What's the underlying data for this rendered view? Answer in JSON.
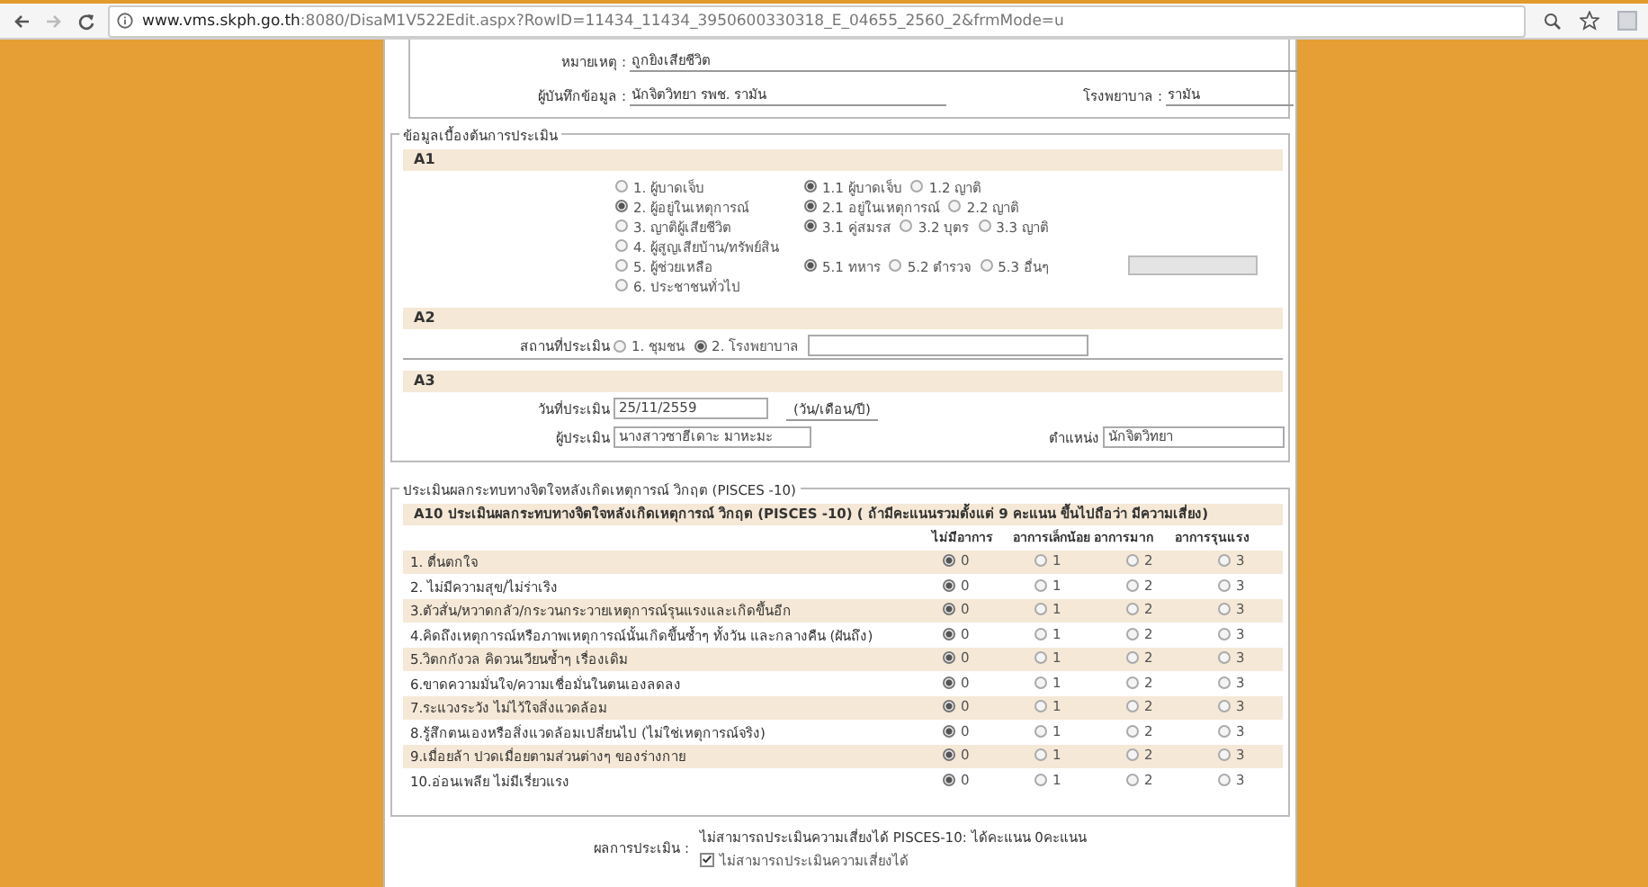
{
  "browser": {
    "url_host": "www.vms.skph.go.th",
    "url_rest": ":8080/DisaM1V522Edit.aspx?RowID=11434_11434_3950600330318_E_04655_2560_2&frmMode=u",
    "forward_disabled": true
  },
  "record": {
    "note_label": "หมายเหตุ :",
    "note": "ถูกยิงเสียชีวิต",
    "recorder_label": "ผู้บันทึกข้อมูล :",
    "recorder": "นักจิตวิทยา รพช. รามัน",
    "hospital_label": "โรงพยาบาล :",
    "hospital": "รามัน"
  },
  "basic_info": {
    "legend": "ข้อมูลเบื้องต้นการประเมิน",
    "a1": {
      "title": "A1",
      "options": [
        {
          "label": "1. ผู้บาดเจ็บ",
          "selected": false,
          "sub_options": [
            {
              "label": "1.1 ผู้บาดเจ็บ",
              "selected": true
            },
            {
              "label": "1.2 ญาติ",
              "selected": false
            }
          ]
        },
        {
          "label": "2. ผู้อยู่ในเหตุการณ์",
          "selected": true,
          "sub_options": [
            {
              "label": "2.1 อยู่ในเหตุการณ์",
              "selected": true
            },
            {
              "label": "2.2 ญาติ",
              "selected": false
            }
          ]
        },
        {
          "label": "3. ญาติผู้เสียชีวิต",
          "selected": false,
          "sub_options": [
            {
              "label": "3.1 คู่สมรส",
              "selected": true
            },
            {
              "label": "3.2 บุตร",
              "selected": false
            },
            {
              "label": "3.3 ญาติ",
              "selected": false
            }
          ]
        },
        {
          "label": "4. ผู้สูญเสียบ้าน/ทรัพย์สิน",
          "selected": false
        },
        {
          "label": "5. ผู้ช่วยเหลือ",
          "selected": false,
          "sub_options": [
            {
              "label": "5.1 ทหาร",
              "selected": true
            },
            {
              "label": "5.2 ตำรวจ",
              "selected": false
            },
            {
              "label": "5.3 อื่นๆ",
              "selected": false
            }
          ],
          "other_field": {
            "disabled": true
          }
        },
        {
          "label": "6. ประชาชนทั่วไป",
          "selected": false
        }
      ]
    },
    "a2": {
      "title": "A2",
      "label": "สถานที่ประเมิน",
      "options": [
        {
          "label": "1. ชุมชน",
          "selected": false
        },
        {
          "label": "2. โรงพยาบาล",
          "selected": true
        }
      ]
    },
    "a3": {
      "title": "A3",
      "date_label": "วันที่ประเมิน",
      "date": "25/11/2559",
      "date_hint": "(วัน/เดือน/ปี)",
      "assessor_label": "ผู้ประเมิน",
      "assessor": "นางสาวซาฮีเดาะ มาหะมะ",
      "position_label": "ตำแหน่ง",
      "position": "นักจิตวิทยา"
    }
  },
  "pisces": {
    "legend": "ประเมินผลกระทบทางจิตใจหลังเกิดเหตุการณ์ วิกฤต (PISCES -10)",
    "header": "A10 ประเมินผลกระทบทางจิตใจหลังเกิดเหตุการณ์ วิกฤต (PISCES -10) ( ถ้ามีคะแนนรวมตั้งแต่ 9 คะแนน ขึ้นไปถือว่า มีความเสี่ยง)",
    "columns": [
      "ไม่มีอาการ",
      "อาการเล็กน้อย",
      "อาการมาก",
      "อาการรุนแรง"
    ],
    "rows": [
      {
        "label": "1. ตื่นตกใจ",
        "options": [
          {
            "label": "0",
            "selected": true
          },
          {
            "label": "1",
            "selected": false
          },
          {
            "label": "2",
            "selected": false
          },
          {
            "label": "3",
            "selected": false
          }
        ]
      },
      {
        "label": "2. ไม่มีความสุข/ไม่ร่าเริง",
        "options": [
          {
            "label": "0",
            "selected": true
          },
          {
            "label": "1",
            "selected": false
          },
          {
            "label": "2",
            "selected": false
          },
          {
            "label": "3",
            "selected": false
          }
        ]
      },
      {
        "label": "3.ตัวสั่น/หวาดกลัว/กระวนกระวายเหตุการณ์รุนแรงและเกิดขึ้นอีก",
        "options": [
          {
            "label": "0",
            "selected": true
          },
          {
            "label": "1",
            "selected": false
          },
          {
            "label": "2",
            "selected": false
          },
          {
            "label": "3",
            "selected": false
          }
        ]
      },
      {
        "label": "4.คิดถึงเหตุการณ์หรือภาพเหตุการณ์นั้นเกิดขึ้นซ้ำๆ ทั้งวัน และกลางคืน (ฝันถึง)",
        "options": [
          {
            "label": "0",
            "selected": true
          },
          {
            "label": "1",
            "selected": false
          },
          {
            "label": "2",
            "selected": false
          },
          {
            "label": "3",
            "selected": false
          }
        ]
      },
      {
        "label": "5.วิตกกังวล คิดวนเวียนซ้ำๆ เรื่องเดิม",
        "options": [
          {
            "label": "0",
            "selected": true
          },
          {
            "label": "1",
            "selected": false
          },
          {
            "label": "2",
            "selected": false
          },
          {
            "label": "3",
            "selected": false
          }
        ]
      },
      {
        "label": "6.ขาดความมั่นใจ/ความเชื่อมั่นในตนเองลดลง",
        "options": [
          {
            "label": "0",
            "selected": true
          },
          {
            "label": "1",
            "selected": false
          },
          {
            "label": "2",
            "selected": false
          },
          {
            "label": "3",
            "selected": false
          }
        ]
      },
      {
        "label": "7.ระแวงระวัง ไม่ไว้ใจสิ่งแวดล้อม",
        "options": [
          {
            "label": "0",
            "selected": true
          },
          {
            "label": "1",
            "selected": false
          },
          {
            "label": "2",
            "selected": false
          },
          {
            "label": "3",
            "selected": false
          }
        ]
      },
      {
        "label": "8.รู้สึกตนเองหรือสิ่งแวดล้อมเปลี่ยนไป (ไม่ใช่เหตุการณ์จริง)",
        "options": [
          {
            "label": "0",
            "selected": true
          },
          {
            "label": "1",
            "selected": false
          },
          {
            "label": "2",
            "selected": false
          },
          {
            "label": "3",
            "selected": false
          }
        ]
      },
      {
        "label": "9.เมื่อยล้า ปวดเมื่อยตามส่วนต่างๆ ของร่างกาย",
        "options": [
          {
            "label": "0",
            "selected": true
          },
          {
            "label": "1",
            "selected": false
          },
          {
            "label": "2",
            "selected": false
          },
          {
            "label": "3",
            "selected": false
          }
        ]
      },
      {
        "label": "10.อ่อนเพลีย ไม่มีเรี่ยวแรง",
        "options": [
          {
            "label": "0",
            "selected": true
          },
          {
            "label": "1",
            "selected": false
          },
          {
            "label": "2",
            "selected": false
          },
          {
            "label": "3",
            "selected": false
          }
        ]
      }
    ]
  },
  "result": {
    "label": "ผลการประเมิน :",
    "summary": "ไม่สามารถประเมินความเสี่ยงได้ PISCES-10: ได้คะแนน 0คะแนน",
    "checkbox": {
      "label": "ไม่สามารถประเมินความเสี่ยงได้",
      "checked": true
    }
  }
}
